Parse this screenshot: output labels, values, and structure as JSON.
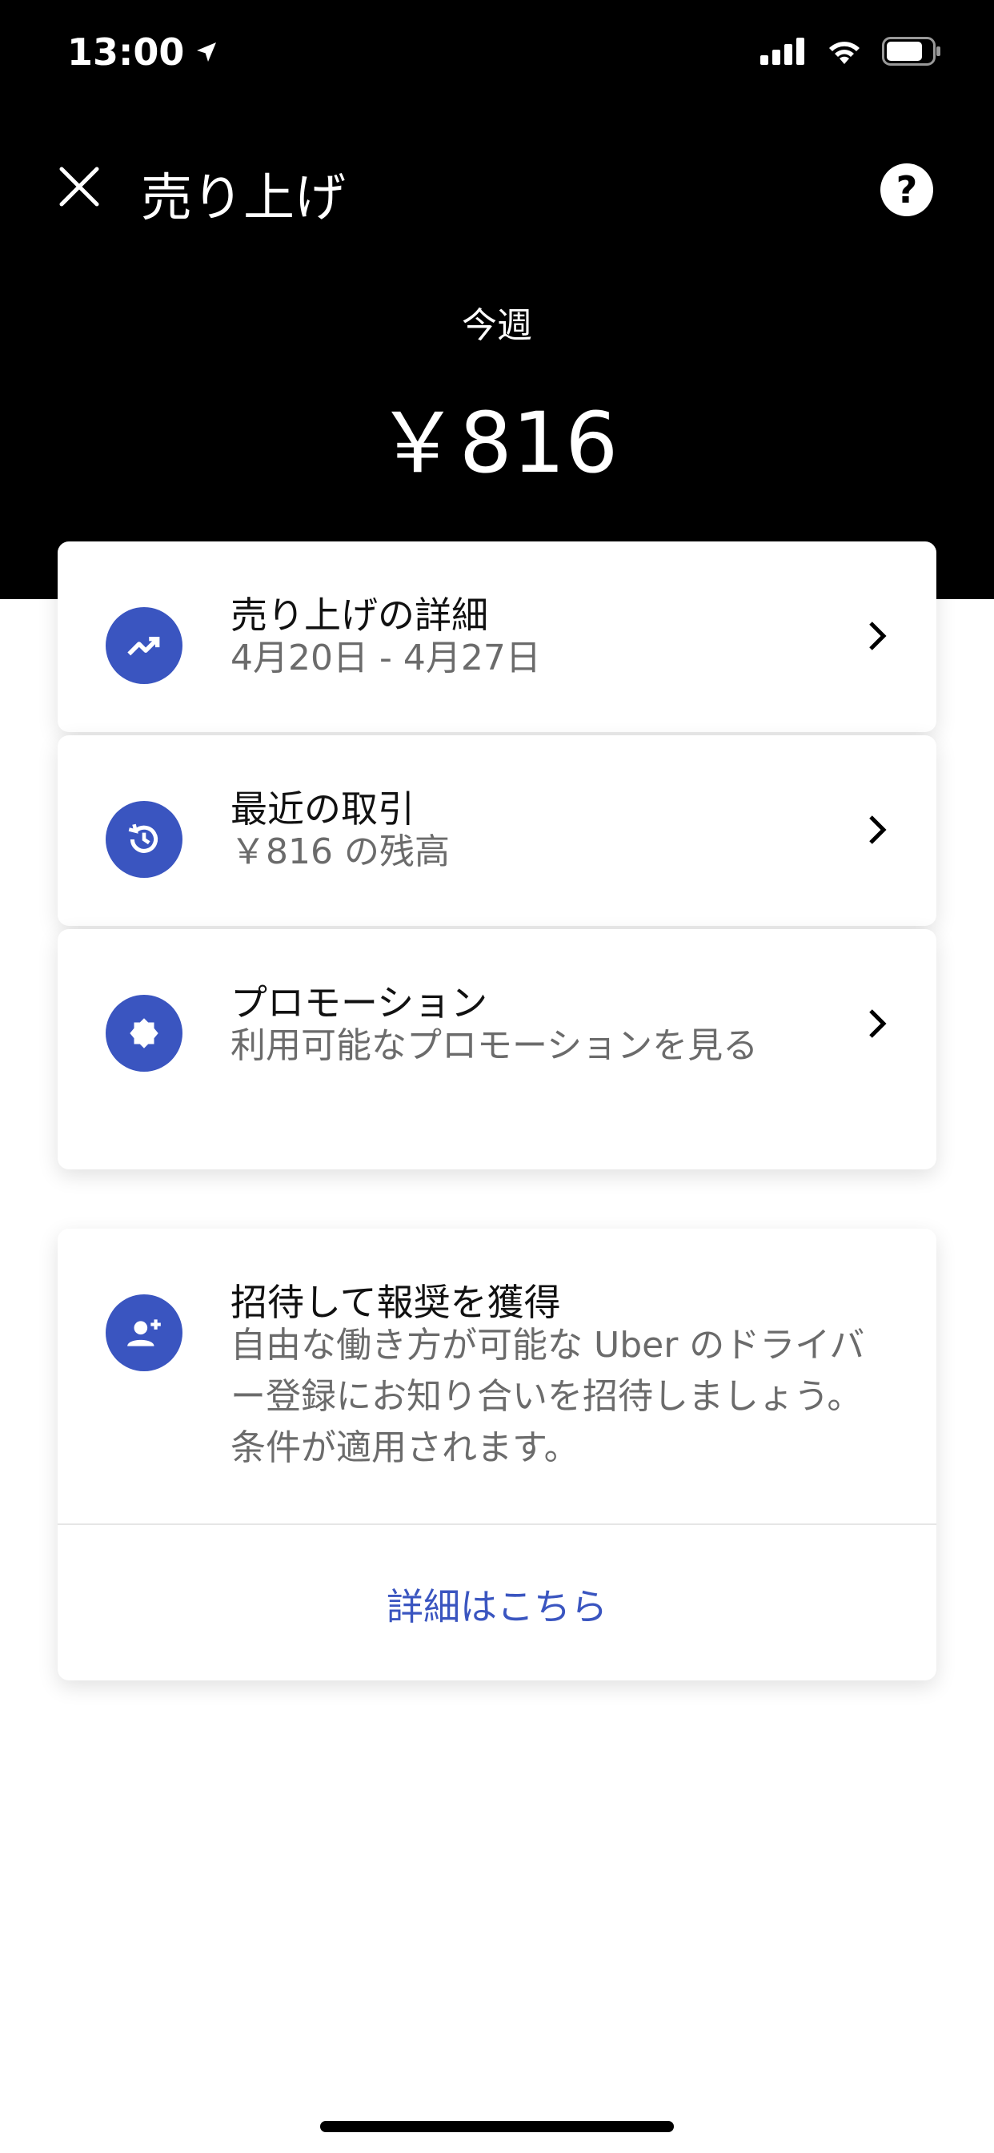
{
  "status_bar": {
    "time": "13:00",
    "icons": [
      "location-arrow-icon",
      "cellular-signal-icon",
      "wifi-icon",
      "battery-icon"
    ]
  },
  "header": {
    "title": "売り上げ",
    "period_label": "今週",
    "amount": "￥816",
    "background": "#000000"
  },
  "rows": [
    {
      "title": "売り上げの詳細",
      "subtitle": "4月20日 - 4月27日",
      "icon": "trending-up-icon"
    },
    {
      "title": "最近の取引",
      "subtitle": "￥816 の残高",
      "icon": "history-icon"
    },
    {
      "title": "プロモーション",
      "subtitle": "利用可能なプロモーションを見る",
      "icon": "badge-icon"
    }
  ],
  "referral": {
    "title": "招待して報奨を獲得",
    "body": "自由な働き方が可能な Uber のドライバー登録にお知り合いを招待しましょう。条件が適用されます。",
    "link": "詳細はこちら",
    "icon": "add-person-icon"
  },
  "colors": {
    "accent": "#3a55c0",
    "secondary_text": "#6b6b6b"
  }
}
